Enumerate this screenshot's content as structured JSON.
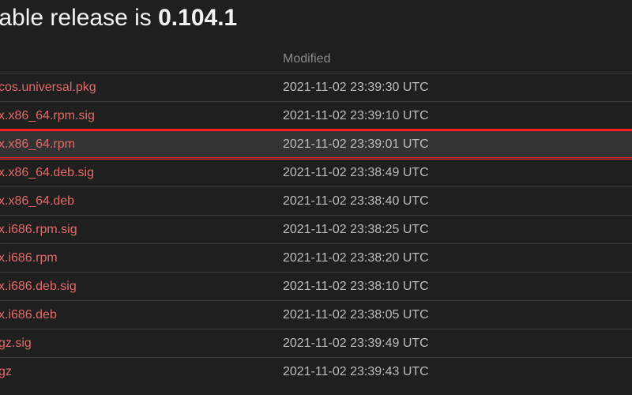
{
  "heading": {
    "prefix": "table release is ",
    "version": "0.104.1"
  },
  "columns": {
    "name": "",
    "modified": "Modified"
  },
  "files": [
    {
      "name": "cos.universal.pkg",
      "modified": "2021-11-02 23:39:30 UTC",
      "highlight": false
    },
    {
      "name": "x.x86_64.rpm.sig",
      "modified": "2021-11-02 23:39:10 UTC",
      "highlight": false
    },
    {
      "name": "x.x86_64.rpm",
      "modified": "2021-11-02 23:39:01 UTC",
      "highlight": true
    },
    {
      "name": "x.x86_64.deb.sig",
      "modified": "2021-11-02 23:38:49 UTC",
      "highlight": false
    },
    {
      "name": "x.x86_64.deb",
      "modified": "2021-11-02 23:38:40 UTC",
      "highlight": false
    },
    {
      "name": "x.i686.rpm.sig",
      "modified": "2021-11-02 23:38:25 UTC",
      "highlight": false
    },
    {
      "name": "x.i686.rpm",
      "modified": "2021-11-02 23:38:20 UTC",
      "highlight": false
    },
    {
      "name": "x.i686.deb.sig",
      "modified": "2021-11-02 23:38:10 UTC",
      "highlight": false
    },
    {
      "name": "x.i686.deb",
      "modified": "2021-11-02 23:38:05 UTC",
      "highlight": false
    },
    {
      "name": "gz.sig",
      "modified": "2021-11-02 23:39:49 UTC",
      "highlight": false
    },
    {
      "name": "gz",
      "modified": "2021-11-02 23:39:43 UTC",
      "highlight": false
    }
  ]
}
